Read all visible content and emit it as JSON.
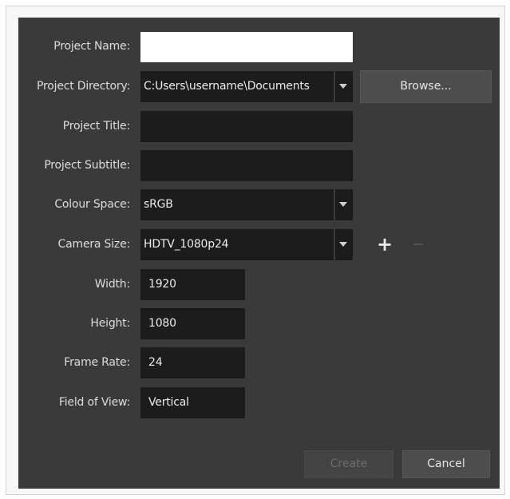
{
  "dialog": {
    "fields": {
      "project_name": {
        "label": "Project Name:",
        "value": ""
      },
      "project_directory": {
        "label": "Project Directory:",
        "value": "C:Users\\username\\Documents"
      },
      "project_title": {
        "label": "Project Title:",
        "value": ""
      },
      "project_subtitle": {
        "label": "Project Subtitle:",
        "value": ""
      },
      "colour_space": {
        "label": "Colour Space:",
        "value": "sRGB"
      },
      "camera_size": {
        "label": "Camera Size:",
        "value": "HDTV_1080p24"
      },
      "width": {
        "label": "Width:",
        "value": "1920"
      },
      "height": {
        "label": "Height:",
        "value": "1080"
      },
      "frame_rate": {
        "label": "Frame Rate:",
        "value": "24"
      },
      "field_of_view": {
        "label": "Field of View:",
        "value": "Vertical"
      }
    },
    "browse_label": "Browse...",
    "add_glyph": "+",
    "create_label": "Create",
    "cancel_label": "Cancel",
    "icons": [
      "dropdown-arrow-icon",
      "plus-icon",
      "minus-icon"
    ]
  }
}
